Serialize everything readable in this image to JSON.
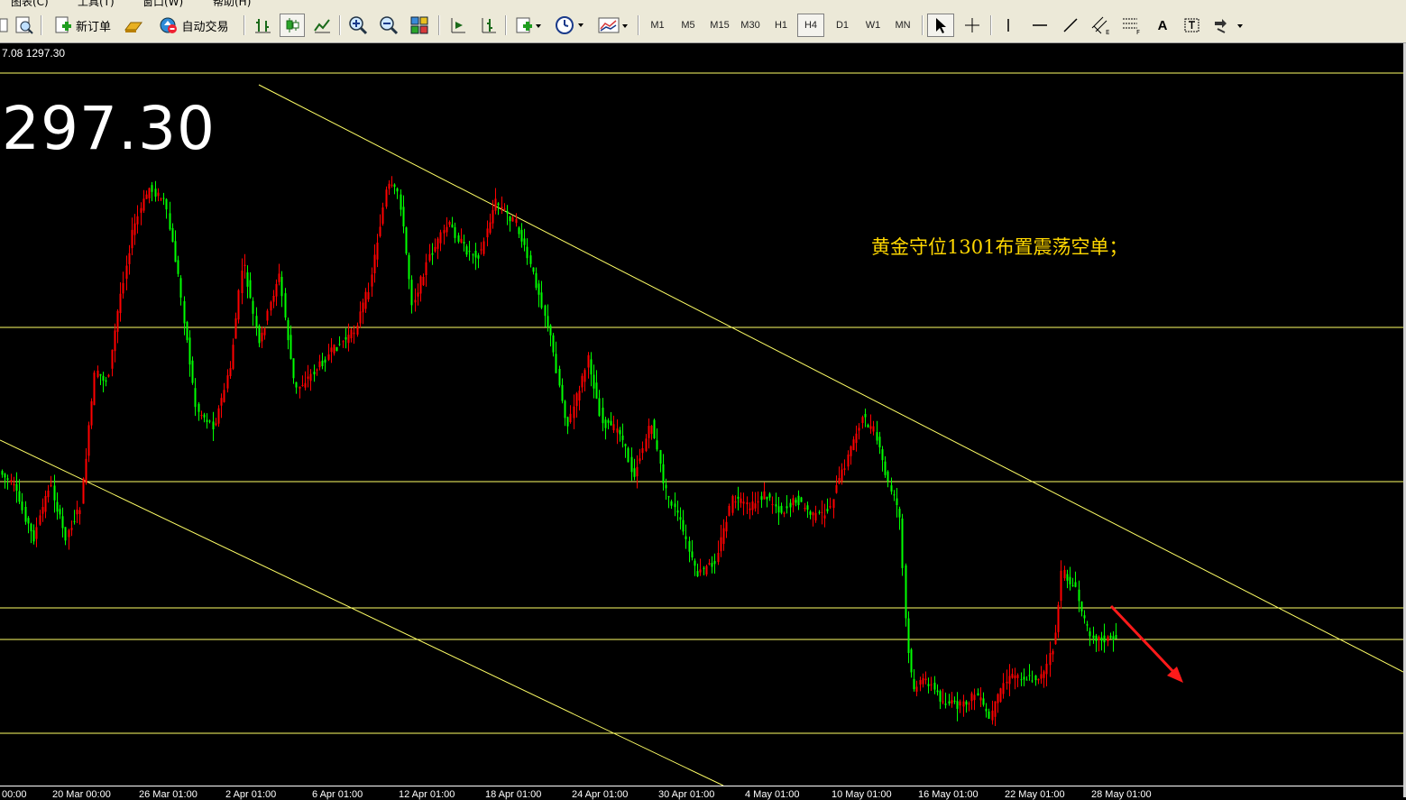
{
  "menu": [
    "图表(C)",
    "工具(T)",
    "窗口(W)",
    "帮助(H)"
  ],
  "toolbar": {
    "new_order": "新订单",
    "auto_trade": "自动交易",
    "timeframes": [
      "M1",
      "M5",
      "M15",
      "M30",
      "H1",
      "H4",
      "D1",
      "W1",
      "MN"
    ],
    "active_timeframe": "H4",
    "text_tool": "A"
  },
  "chart": {
    "header_info": "7.08 1297.30",
    "current_price": "297.30",
    "annotation": "黄金守位1301布置震荡空单；",
    "colors": {
      "background": "#000000",
      "bull_candle": "#ff0000",
      "bear_candle": "#00ff00",
      "levels": "#ffff66",
      "arrow": "#ff1a1a",
      "annotation": "#ffd700"
    },
    "x_labels": [
      "00:00",
      "20 Mar 00:00",
      "26 Mar 01:00",
      "2 Apr 01:00",
      "6 Apr 01:00",
      "12 Apr 01:00",
      "18 Apr 01:00",
      "24 Apr 01:00",
      "30 Apr 01:00",
      "4 May 01:00",
      "10 May 01:00",
      "16 May 01:00",
      "22 May 01:00",
      "28 May 01:00"
    ]
  }
}
